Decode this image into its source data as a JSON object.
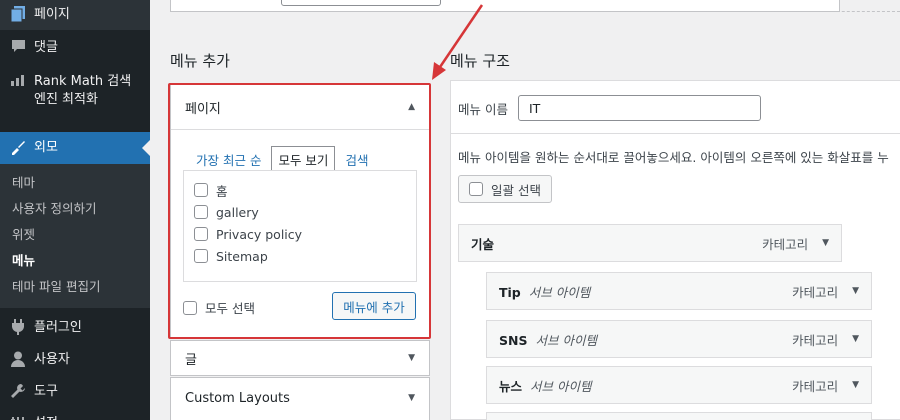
{
  "sidebar": {
    "items": [
      {
        "label": "페이지",
        "icon": "pages-icon"
      },
      {
        "label": "댓글",
        "icon": "comments-icon"
      },
      {
        "label": "Rank Math 검색엔진 최적화",
        "icon": "rank-math-icon"
      },
      {
        "label": "외모",
        "icon": "appearance-icon"
      },
      {
        "label": "플러그인",
        "icon": "plugins-icon"
      },
      {
        "label": "사용자",
        "icon": "users-icon"
      },
      {
        "label": "도구",
        "icon": "tools-icon"
      },
      {
        "label": "설정",
        "icon": "settings-icon"
      }
    ],
    "submenu": [
      "테마",
      "사용자 정의하기",
      "위젯",
      "메뉴",
      "테마 파일 편집기"
    ]
  },
  "add_menu": {
    "heading": "메뉴 추가",
    "pages_panel": {
      "title": "페이지",
      "tabs": [
        "가장 최근 순",
        "모두 보기",
        "검색"
      ],
      "items": [
        "홈",
        "gallery",
        "Privacy policy",
        "Sitemap"
      ],
      "select_all": "모두 선택",
      "add_button": "메뉴에 추가"
    },
    "posts_panel": {
      "title": "글"
    },
    "custom_layouts_panel": {
      "title": "Custom Layouts"
    }
  },
  "menu_structure": {
    "heading": "메뉴 구조",
    "name_label": "메뉴 이름",
    "name_value": "IT",
    "instructions": "메뉴 아이템을 원하는 순서대로 끌어놓으세요. 아이템의 오른쪽에 있는 화살표를 누",
    "bulk_select": "일괄 선택",
    "items": [
      {
        "title": "기술",
        "sub": "",
        "type": "카테고리"
      },
      {
        "title": "Tip",
        "sub": "서브 아이템",
        "type": "카테고리"
      },
      {
        "title": "SNS",
        "sub": "서브 아이템",
        "type": "카테고리"
      },
      {
        "title": "뉴스",
        "sub": "서브 아이템",
        "type": "카테고리"
      }
    ]
  },
  "colors": {
    "accent": "#2271b1",
    "highlight": "#d63638",
    "sidebar": "#1d2327"
  }
}
